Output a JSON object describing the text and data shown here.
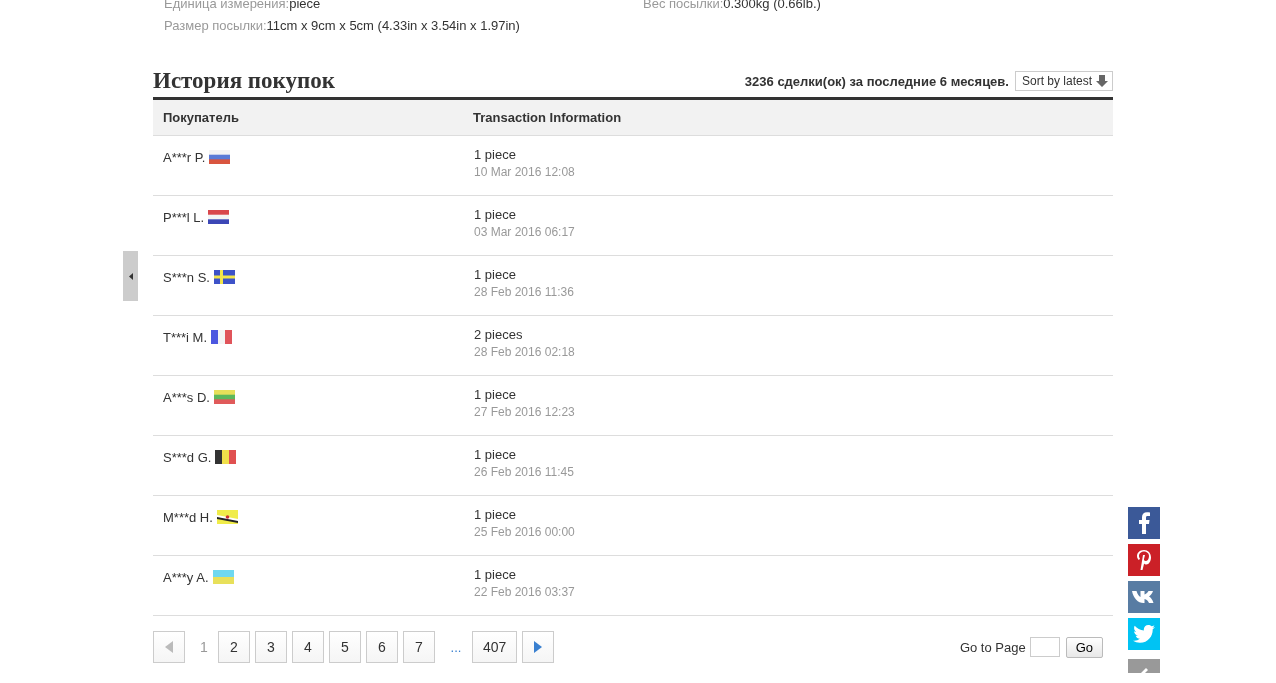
{
  "specs": [
    {
      "label": "Единица измерения:",
      "value": "piece"
    },
    {
      "label": "Вес посылки:",
      "value": "0.300kg (0.66lb.)"
    },
    {
      "label": "Размер посылки:",
      "value": "11cm x 9cm x 5cm (4.33in x 3.54in x 1.97in)"
    }
  ],
  "history": {
    "title": "История покупок",
    "summary": "3236 сделки(ок) за последние 6 месяцев.",
    "sort_button": "Sort by latest"
  },
  "table": {
    "columns": [
      "Покупатель",
      "Transaction Information"
    ],
    "rows": [
      {
        "buyer": "A***r P.",
        "kind": "ru",
        "quantity": "1 piece",
        "date": "10 Mar 2016 12:08"
      },
      {
        "buyer": "P***l L.",
        "kind": "nl",
        "quantity": "1 piece",
        "date": "03 Mar 2016 06:17"
      },
      {
        "buyer": "S***n S.",
        "kind": "se",
        "quantity": "1 piece",
        "date": "28 Feb 2016 11:36"
      },
      {
        "buyer": "T***i M.",
        "kind": "fr",
        "quantity": "2 pieces",
        "date": "28 Feb 2016 02:18"
      },
      {
        "buyer": "A***s D.",
        "kind": "lt",
        "quantity": "1 piece",
        "date": "27 Feb 2016 12:23"
      },
      {
        "buyer": "S***d G.",
        "kind": "be",
        "quantity": "1 piece",
        "date": "26 Feb 2016 11:45"
      },
      {
        "buyer": "M***d H.",
        "kind": "bn",
        "quantity": "1 piece",
        "date": "25 Feb 2016 00:00"
      },
      {
        "buyer": "A***y A.",
        "kind": "ua",
        "quantity": "1 piece",
        "date": "22 Feb 2016 03:37"
      }
    ]
  },
  "pagination": {
    "prev_disabled": true,
    "next_disabled": false,
    "pages": [
      {
        "kind": "page",
        "label": "1",
        "selected": true
      },
      {
        "kind": "page",
        "label": "2",
        "selected": false
      },
      {
        "kind": "page",
        "label": "3",
        "selected": false
      },
      {
        "kind": "page",
        "label": "4",
        "selected": false
      },
      {
        "kind": "page",
        "label": "5",
        "selected": false
      },
      {
        "kind": "page",
        "label": "6",
        "selected": false
      },
      {
        "kind": "page",
        "label": "7",
        "selected": false
      },
      {
        "kind": "ellipsis",
        "label": "..."
      },
      {
        "kind": "page",
        "label": "407",
        "selected": false
      }
    ],
    "goto_label": "Go to Page",
    "go_button": "Go"
  }
}
